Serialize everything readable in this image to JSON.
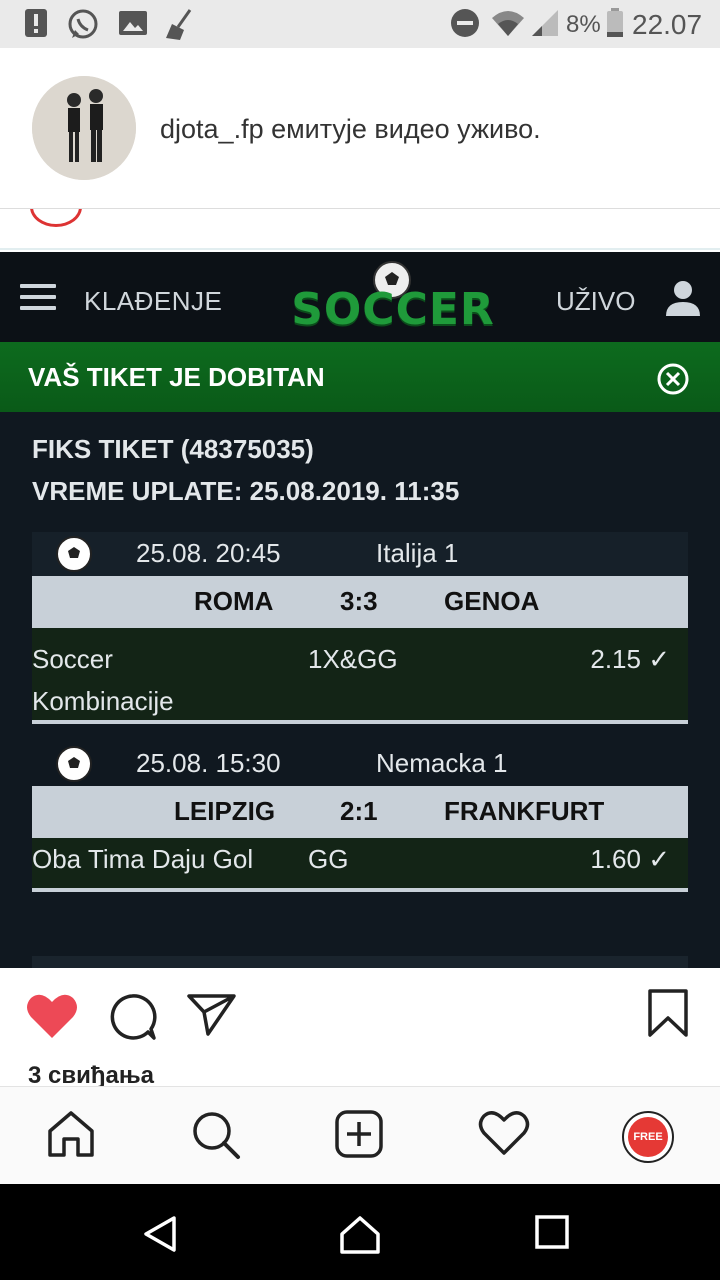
{
  "status_bar": {
    "battery_percent": "8%",
    "time": "22.07"
  },
  "notification": {
    "text": "djota_.fp емитује видео уживо."
  },
  "post_image": {
    "top_bar": {
      "menu_label": "KLAĐENJE",
      "logo_text": "SOCCER",
      "live_label": "UŽIVO"
    },
    "win_banner": {
      "text": "VAŠ TIKET JE DOBITAN"
    },
    "ticket": {
      "title": "FIKS TIKET (48375035)",
      "payment_time": "VREME UPLATE: 25.08.2019. 11:35"
    },
    "matches": [
      {
        "datetime": "25.08. 20:45",
        "league": "Italija 1",
        "home": "ROMA",
        "score": "3:3",
        "away": "GENOA",
        "bet_type_line1": "Soccer",
        "bet_type_line2": "Kombinacije",
        "pick": "1X&GG",
        "odds": "2.15 ✓"
      },
      {
        "datetime": "25.08. 15:30",
        "league": "Nemacka 1",
        "home": "LEIPZIG",
        "score": "2:1",
        "away": "FRANKFURT",
        "bet_type_line1": "Oba Tima Daju Gol",
        "bet_type_line2": "",
        "pick": "GG",
        "odds": "1.60 ✓"
      }
    ]
  },
  "post_actions": {
    "likes": "3 свиђања"
  },
  "colors": {
    "like_red": "#ed4956",
    "win_green": "#0d6b1e",
    "dark_bg": "#101820"
  },
  "icons": {
    "post_actions": [
      "heart-icon",
      "comment-icon",
      "send-icon",
      "bookmark-icon"
    ],
    "bottom_nav": [
      "home-icon",
      "search-icon",
      "add-post-icon",
      "activity-heart-icon",
      "profile-avatar"
    ],
    "system_nav": [
      "back-icon",
      "home-icon",
      "recents-icon"
    ]
  },
  "profile_badge": "FREE"
}
